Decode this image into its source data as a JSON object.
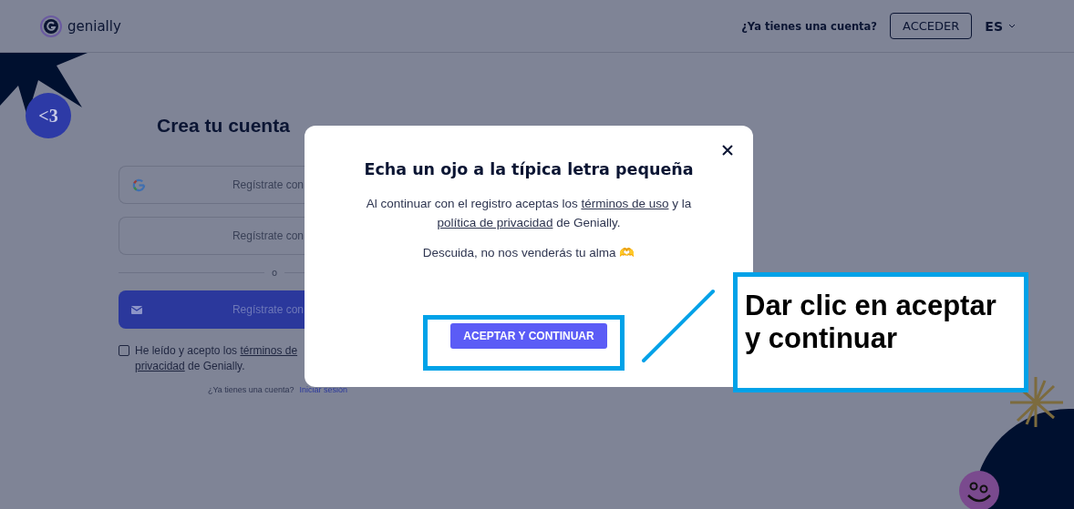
{
  "header": {
    "brand": "genially",
    "account_prompt": "¿Ya tienes una cuenta?",
    "login_button": "ACCEDER",
    "language": "ES"
  },
  "badge": "<3",
  "signup": {
    "title": "Crea tu cuenta",
    "google_button": "Regístrate con",
    "second_button": "Regístrate con",
    "divider": "o",
    "email_button": "Regístrate con",
    "terms": {
      "checked": false,
      "prefix": "He leído y acepto los ",
      "link1": "términos de",
      "link2": "privacidad",
      "suffix": " de Genially."
    },
    "footer_prompt": "¿Ya tienes una cuenta?",
    "footer_link": "Iniciar sesión"
  },
  "modal": {
    "title": "Echa un ojo a la típica letra pequeña",
    "text_prefix": "Al continuar con el registro aceptas los ",
    "link_terms": "términos de uso",
    "text_middle": " y la ",
    "link_privacy": "política de privacidad",
    "text_suffix": " de Genially.",
    "note": "Descuida, no nos venderás tu alma 🫶",
    "accept_button": "ACEPTAR Y CONTINUAR"
  },
  "annotation": {
    "text": "Dar clic en aceptar y continuar"
  }
}
